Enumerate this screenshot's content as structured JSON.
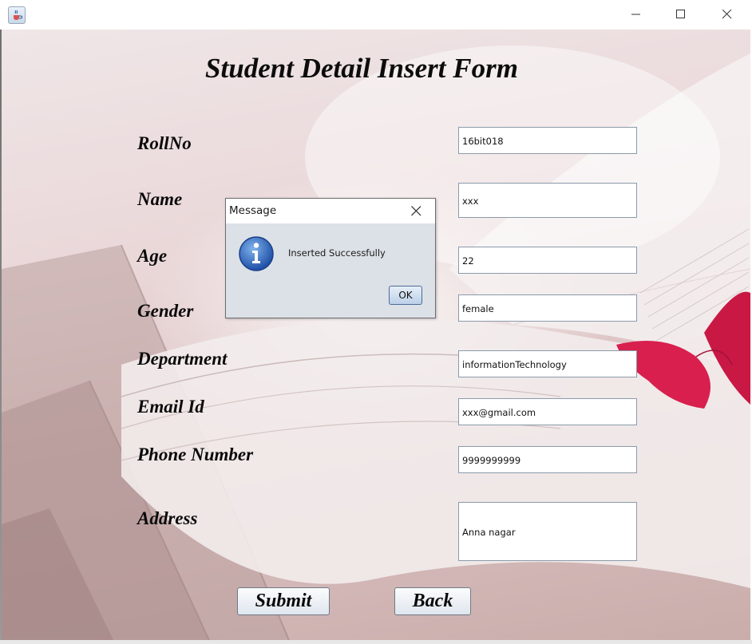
{
  "window": {
    "icon": "java-cup-icon"
  },
  "form": {
    "title": "Student Detail Insert Form",
    "fields": [
      {
        "label": "RollNo",
        "value": "16bit018"
      },
      {
        "label": "Name",
        "value": "xxx"
      },
      {
        "label": "Age",
        "value": "22"
      },
      {
        "label": "Gender",
        "value": "female"
      },
      {
        "label": "Department",
        "value": "informationTechnology"
      },
      {
        "label": "Email Id",
        "value": "xxx@gmail.com"
      },
      {
        "label": "Phone Number",
        "value": "9999999999"
      },
      {
        "label": "Address",
        "value": "Anna nagar"
      }
    ],
    "submit_label": "Submit",
    "back_label": "Back"
  },
  "dialog": {
    "title": "Message",
    "message": "Inserted Successfully",
    "ok_label": "OK",
    "icon": "info-icon"
  }
}
